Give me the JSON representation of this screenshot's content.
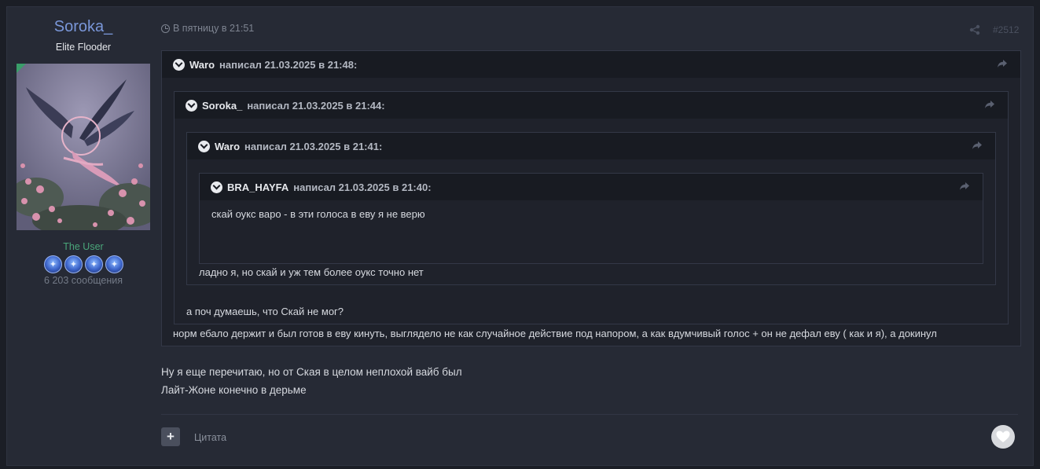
{
  "author": {
    "name": "Soroka_",
    "title": "Elite Flooder",
    "group": "The User",
    "messages": "6 203 сообщения",
    "badge_count": 4
  },
  "post": {
    "date": "В пятницу в 21:51",
    "number": "#2512",
    "body_lines": [
      "Ну я еще перечитаю, но от Ская в целом неплохой вайб был",
      "Лайт-Жоне конечно в дерьме"
    ],
    "footer": {
      "plus_label": "+",
      "quote_label": "Цитата"
    }
  },
  "quotes": [
    {
      "author": "Waro",
      "meta": "написал 21.03.2025 в 21:48:",
      "text": "норм ебало держит и был готов в еву кинуть, выглядело не как случайное действие под напором, а как вдумчивый голос + он не дефал еву ( как и я), а докинул"
    },
    {
      "author": "Soroka_",
      "meta": "написал 21.03.2025 в 21:44:",
      "text": "а поч думаешь, что Скай не мог?"
    },
    {
      "author": "Waro",
      "meta": "написал 21.03.2025 в 21:41:",
      "text": "ладно я, но скай и уж тем более оукс точно нет"
    },
    {
      "author": "BRA_HAYFA",
      "meta": "написал 21.03.2025 в 21:40:",
      "text": "скай оукс варо - в эти голоса в еву я не верю"
    }
  ],
  "icons": {
    "clock": "clock-icon",
    "share": "share-icon",
    "reply": "reply-arrow-icon",
    "toggle": "chevron-down-icon",
    "heart": "heart-icon",
    "badge": "achievement-badge-icon"
  },
  "colors": {
    "author_name": "#7a97d9",
    "group": "#4aa67a",
    "background": "#262a35",
    "quote_bg": "#1f222b"
  }
}
